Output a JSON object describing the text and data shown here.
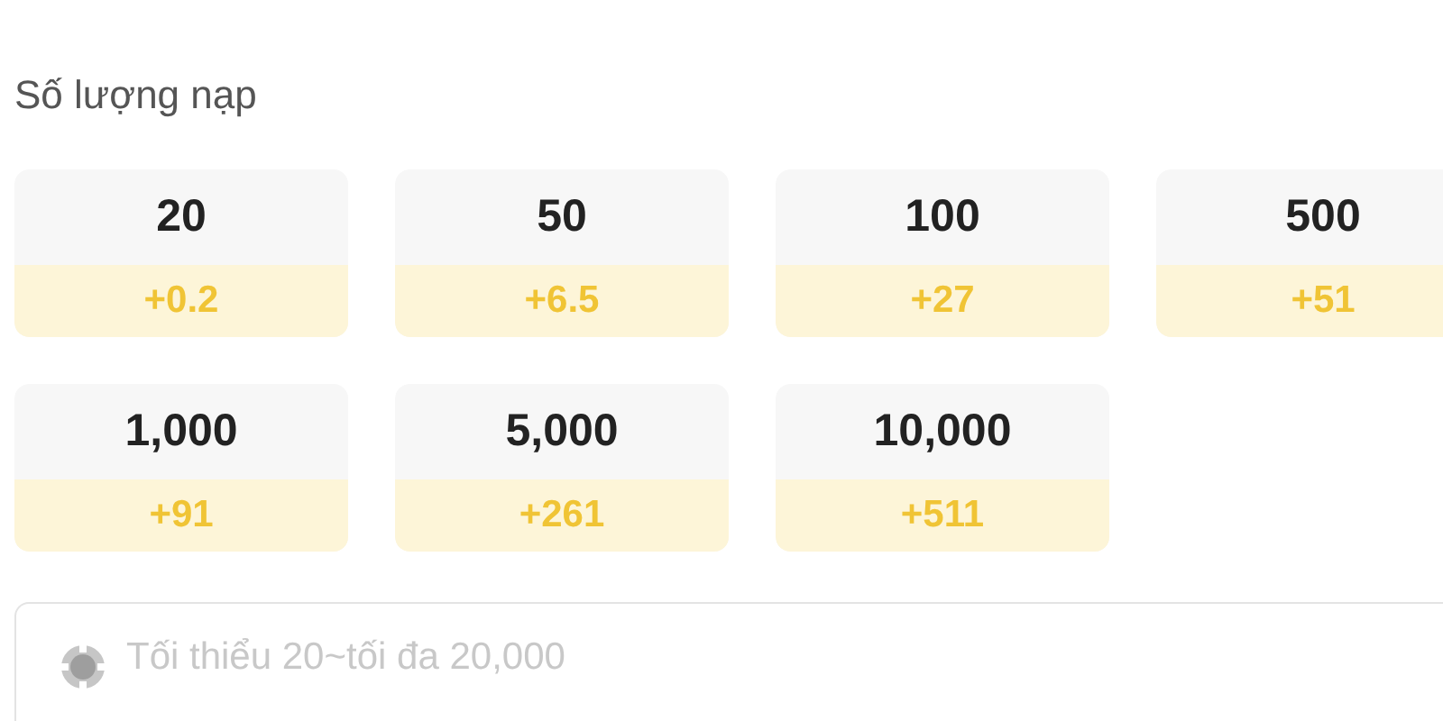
{
  "label": "Số lượng nạp",
  "amounts": [
    {
      "amount": "20",
      "bonus": "+0.2"
    },
    {
      "amount": "50",
      "bonus": "+6.5"
    },
    {
      "amount": "100",
      "bonus": "+27"
    },
    {
      "amount": "500",
      "bonus": "+51"
    },
    {
      "amount": "1,000",
      "bonus": "+91"
    },
    {
      "amount": "5,000",
      "bonus": "+261"
    },
    {
      "amount": "10,000",
      "bonus": "+511"
    }
  ],
  "amount_field": {
    "placeholder": "Tối thiểu 20~tối đa 20,000"
  }
}
